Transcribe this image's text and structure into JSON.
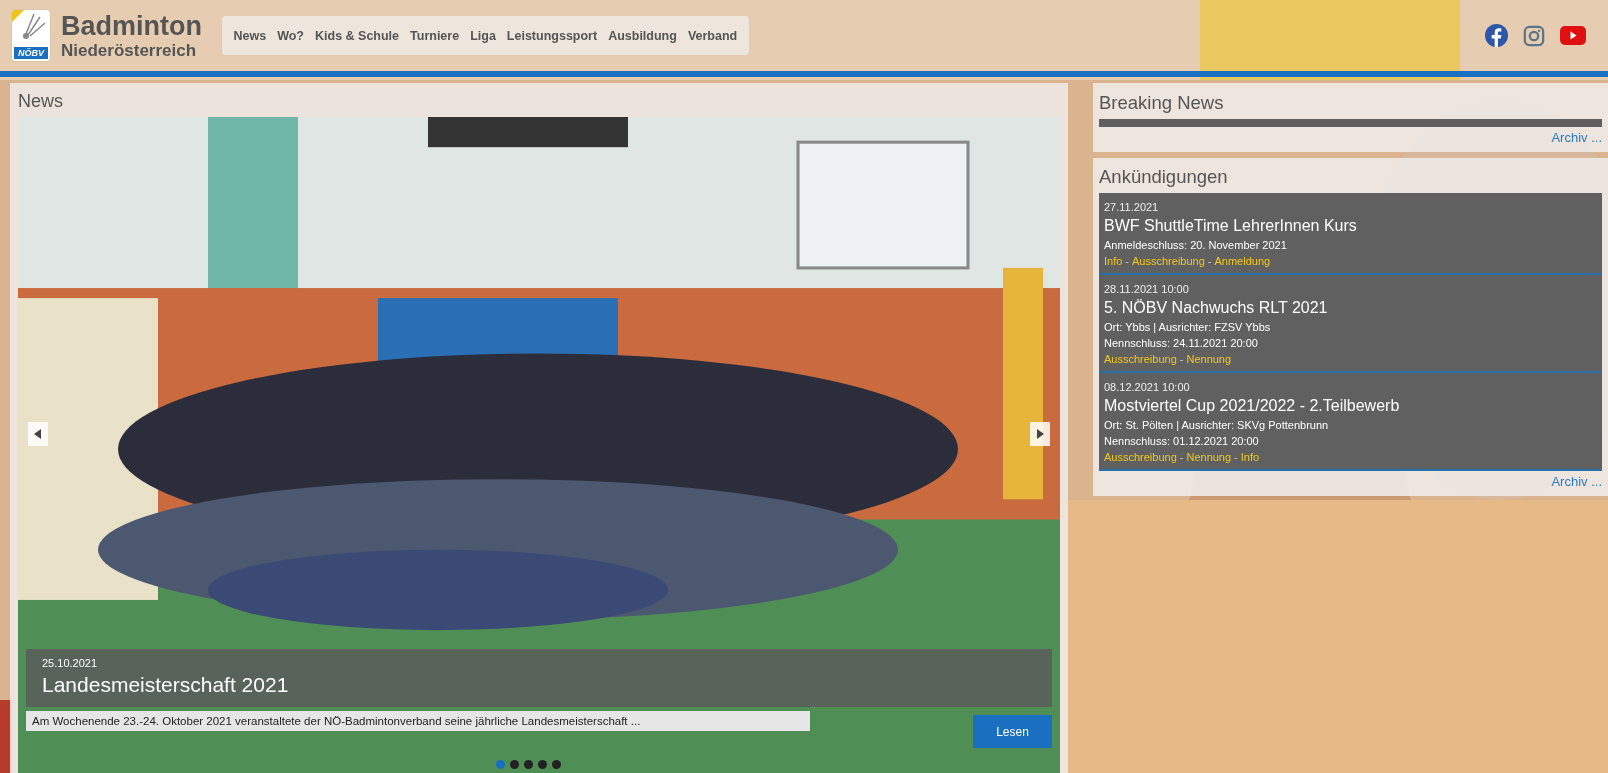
{
  "header": {
    "logo_badge": "NÖBV",
    "title": "Badminton",
    "subtitle": "Niederösterreich",
    "nav": [
      "News",
      "Wo?",
      "Kids & Schule",
      "Turniere",
      "Liga",
      "Leistungssport",
      "Ausbildung",
      "Verband"
    ],
    "social": [
      {
        "kind": "facebook"
      },
      {
        "kind": "instagram"
      },
      {
        "kind": "youtube"
      }
    ]
  },
  "news": {
    "title": "News",
    "slide": {
      "date": "25.10.2021",
      "title": "Landesmeisterschaft 2021",
      "excerpt": "Am Wochenende 23.-24. Oktober 2021 veranstaltete der NÖ-Badmintonverband seine jährliche Landesmeisterschaft ...",
      "button": "Lesen",
      "dots": [
        {
          "selected": true
        },
        {
          "selected": false
        },
        {
          "selected": false
        },
        {
          "selected": false
        },
        {
          "selected": false
        }
      ]
    }
  },
  "breaking_news": {
    "title": "Breaking News",
    "archive_link": "Archiv ..."
  },
  "announcements": {
    "title": "Ankündigungen",
    "separator": "-",
    "archive_link": "Archiv ...",
    "items": [
      {
        "date": "27.11.2021",
        "title": "BWF ShuttleTime LehrerInnen Kurs",
        "lines": [
          "Anmeldeschluss: 20. November 2021"
        ],
        "links": [
          "Info",
          "Ausschreibung",
          "Anmeldung"
        ]
      },
      {
        "date": "28.11.2021 10:00",
        "title": "5. NÖBV Nachwuchs RLT 2021",
        "lines": [
          "Ort: Ybbs | Ausrichter: FZSV Ybbs",
          "Nennschluss: 24.11.2021 20:00"
        ],
        "links": [
          "Ausschreibung",
          "Nennung"
        ]
      },
      {
        "date": "08.12.2021 10:00",
        "title": "Mostviertel Cup 2021/2022 - 2.Teilbewerb",
        "lines": [
          "Ort: St. Pölten | Ausrichter: SKVg Pottenbrunn",
          "Nennschluss: 01.12.2021 20:00"
        ],
        "links": [
          "Ausschreibung",
          "Nennung",
          "Info"
        ]
      }
    ]
  }
}
